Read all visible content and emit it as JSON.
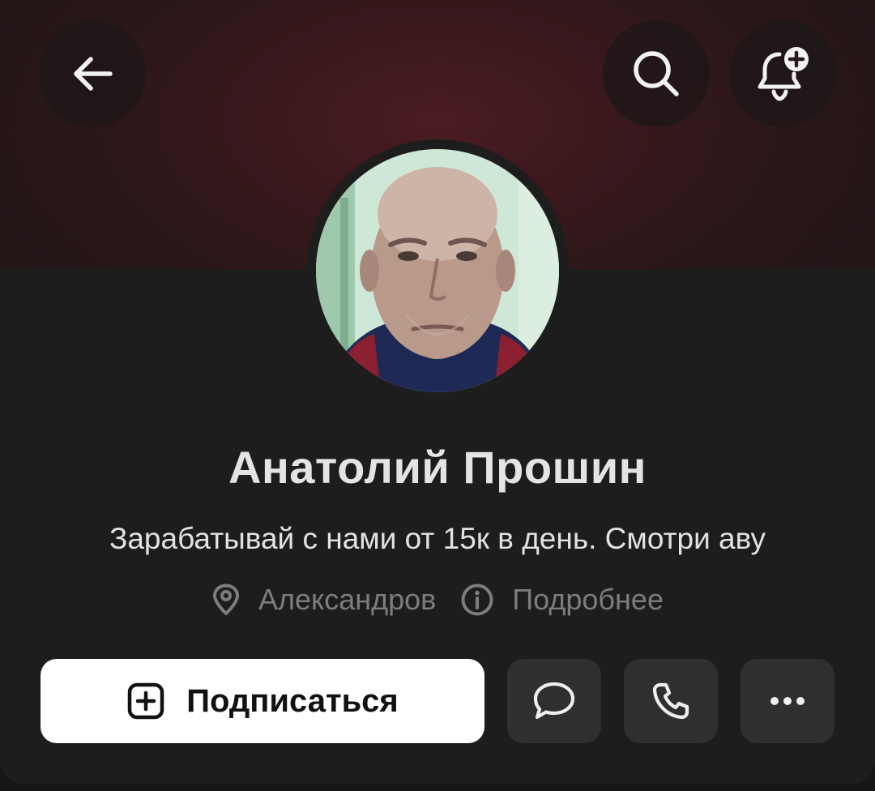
{
  "header": {
    "back_icon": "arrow-left-icon",
    "search_icon": "search-icon",
    "subscribe_notifications_icon": "bell-plus-icon"
  },
  "profile": {
    "name": "Анатолий Прошин",
    "status": "Зарабатывай с нами от 15к в день. Смотри аву",
    "location": "Александров",
    "more_info": "Подробнее",
    "avatar": "profile-photo"
  },
  "actions": {
    "subscribe_label": "Подписаться",
    "subscribe_icon": "plus-square-icon",
    "message_icon": "message-bubble-icon",
    "call_icon": "phone-icon",
    "more_icon": "ellipsis-icon"
  },
  "colors": {
    "background": "#161616",
    "card": "#1d1d1d",
    "cover": "#3a181c",
    "primary_button": "#ffffff",
    "secondary_button": "#2f2f2f",
    "muted_text": "#7d7d7d"
  }
}
